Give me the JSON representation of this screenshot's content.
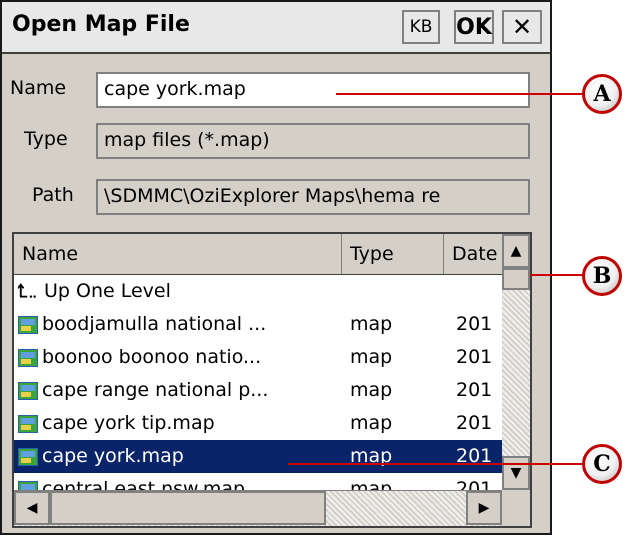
{
  "dialog": {
    "title": "Open Map File",
    "kb_label": "KB",
    "ok_label": "OK",
    "close_label": "✕"
  },
  "form": {
    "name_label": "Name",
    "name_value": "cape york.map",
    "type_label": "Type",
    "type_value": "map files (*.map)",
    "path_label": "Path",
    "path_value": "\\SDMMC\\OziExplorer Maps\\hema re"
  },
  "list": {
    "columns": [
      "Name",
      "Type",
      "Date"
    ],
    "rows": [
      {
        "icon": "up-level-icon",
        "name": "Up One Level",
        "type": "",
        "date": ""
      },
      {
        "icon": "map-file-icon",
        "name": "boodjamulla national ...",
        "type": "map",
        "date": "201"
      },
      {
        "icon": "map-file-icon",
        "name": "boonoo boonoo natio...",
        "type": "map",
        "date": "201"
      },
      {
        "icon": "map-file-icon",
        "name": "cape range national p...",
        "type": "map",
        "date": "201"
      },
      {
        "icon": "map-file-icon",
        "name": "cape york tip.map",
        "type": "map",
        "date": "201"
      },
      {
        "icon": "map-file-icon",
        "name": "cape york.map",
        "type": "map",
        "date": "201",
        "selected": true
      },
      {
        "icon": "map-file-icon",
        "name": "central east nsw.map",
        "type": "map",
        "date": "201"
      }
    ]
  },
  "callouts": [
    "A",
    "B",
    "C"
  ],
  "colors": {
    "selection": "#0a246a",
    "callout_line": "#cc0000",
    "dialog_bg": "#d4d0c8"
  }
}
